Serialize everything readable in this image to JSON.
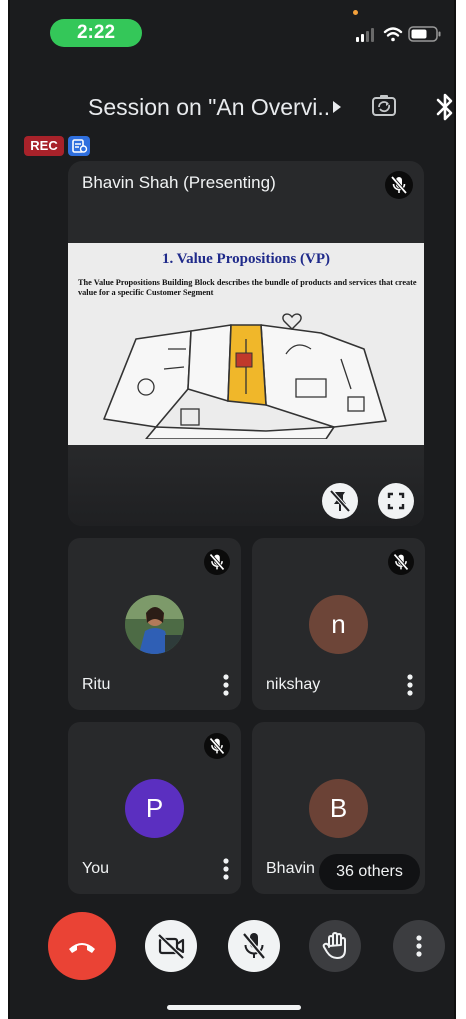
{
  "status_bar": {
    "time": "2:22",
    "icons": [
      "cellular-signal-icon",
      "wifi-icon",
      "battery-icon"
    ]
  },
  "header": {
    "title": "Session on \"An Overvi...",
    "icons": [
      "chevron-right-icon",
      "flip-camera-icon",
      "bluetooth-icon"
    ]
  },
  "badges": {
    "rec": "REC",
    "transcript_icon": "transcript-icon"
  },
  "presenter": {
    "name": "Bhavin Shah (Presenting)",
    "slide": {
      "title": "1. Value Propositions (VP)",
      "body": "The Value Propositions Building Block describes the bundle of products and services that create value for a specific Customer Segment"
    },
    "controls": [
      "unpin-icon",
      "fullscreen-icon"
    ]
  },
  "participants": [
    {
      "name": "Ritu",
      "avatar_type": "photo",
      "muted": true
    },
    {
      "name": "nikshay",
      "avatar_letter": "n",
      "avatar_color": "#6d4538",
      "muted": true
    },
    {
      "name": "You",
      "avatar_letter": "P",
      "avatar_color": "#5b2fc0",
      "muted": true
    },
    {
      "name": "Bhavin",
      "avatar_letter": "B",
      "avatar_color": "#6b4236",
      "muted": false
    }
  ],
  "others_label": "36 others",
  "controls": {
    "end_call": "end-call-icon",
    "camera": "camera-off-icon",
    "mic": "mic-off-icon",
    "hand": "raise-hand-icon",
    "more": "more-options-icon"
  },
  "colors": {
    "background": "#1b1c1e",
    "tile": "#28292b",
    "status_pill": "#34c759",
    "rec": "#a8222a",
    "end_call": "#ea4335",
    "slide_title": "#1f2a8a"
  }
}
